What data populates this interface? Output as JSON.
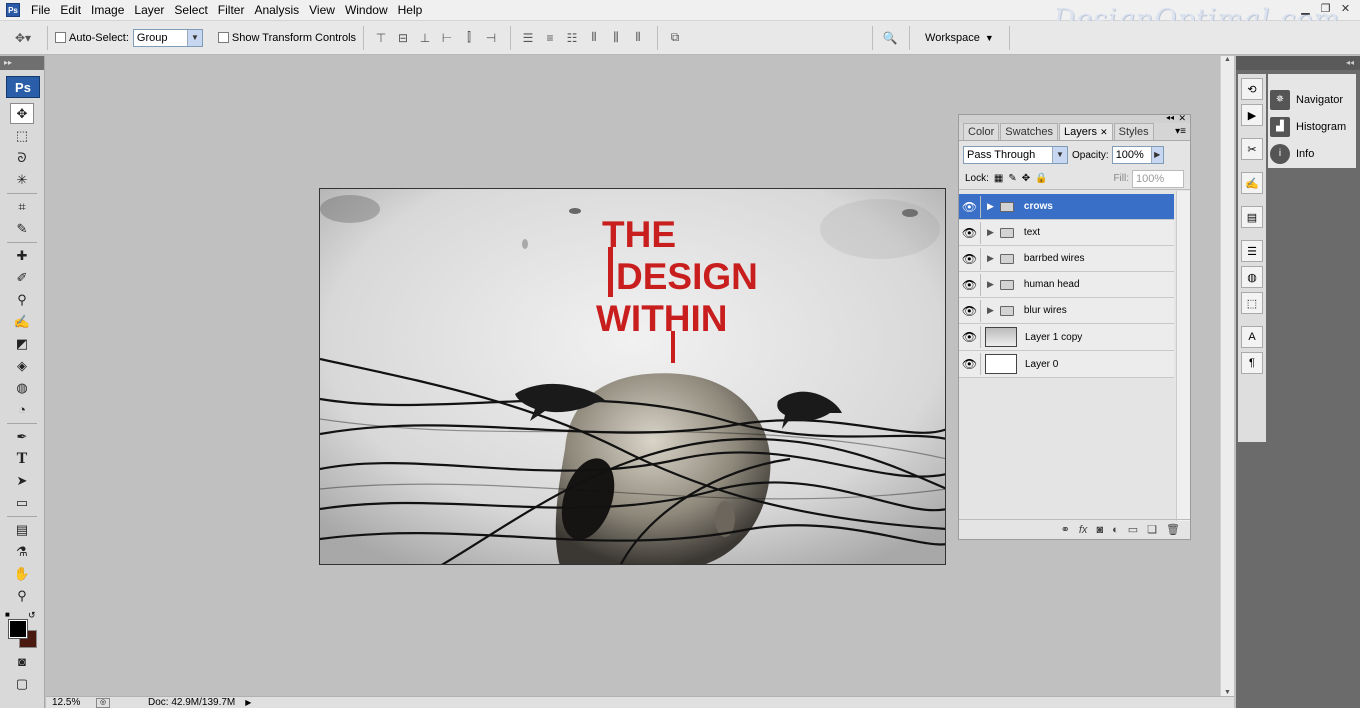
{
  "menubar": {
    "items": [
      "File",
      "Edit",
      "Image",
      "Layer",
      "Select",
      "Filter",
      "Analysis",
      "View",
      "Window",
      "Help"
    ],
    "brand": "DesignOptimal.com"
  },
  "options": {
    "auto_select_label": "Auto-Select:",
    "auto_select_value": "Group",
    "show_transform_label": "Show Transform Controls",
    "workspace_label": "Workspace"
  },
  "toolbox": {
    "logo": "Ps",
    "tools": [
      "move-tool",
      "marquee-tool",
      "lasso-tool",
      "magic-wand-tool",
      "crop-tool",
      "slice-tool",
      "healing-brush-tool",
      "brush-tool",
      "clone-stamp-tool",
      "history-brush-tool",
      "eraser-tool",
      "paint-bucket-tool",
      "blur-tool",
      "dodge-tool",
      "pen-tool",
      "type-tool",
      "path-selection-tool",
      "rectangle-tool",
      "notes-tool",
      "eyedropper-tool",
      "hand-tool",
      "zoom-tool"
    ],
    "foreground_color": "#000000",
    "background_color": "#4a1a10"
  },
  "document": {
    "title_line1": "THE",
    "title_line2": "DESIGN",
    "title_line3": "WITHIN",
    "title_color": "#c81e1e"
  },
  "status": {
    "zoom": "12.5%",
    "doc_size": "Doc: 42.9M/139.7M"
  },
  "layers_panel": {
    "tabs": [
      "Color",
      "Swatches",
      "Layers",
      "Styles"
    ],
    "active_tab": "Layers",
    "blend_mode": "Pass Through",
    "opacity_label": "Opacity:",
    "opacity_value": "100%",
    "lock_label": "Lock:",
    "fill_label": "Fill:",
    "fill_value": "100%",
    "layers": [
      {
        "name": "crows",
        "type": "group",
        "selected": true
      },
      {
        "name": "text",
        "type": "group",
        "selected": false
      },
      {
        "name": "barrbed wires",
        "type": "group",
        "selected": false
      },
      {
        "name": "human head",
        "type": "group",
        "selected": false
      },
      {
        "name": "blur wires",
        "type": "group",
        "selected": false
      },
      {
        "name": "Layer 1 copy",
        "type": "layer",
        "selected": false
      },
      {
        "name": "Layer 0",
        "type": "layer",
        "selected": false
      }
    ]
  },
  "dock": {
    "panels": [
      "Navigator",
      "Histogram",
      "Info"
    ]
  }
}
